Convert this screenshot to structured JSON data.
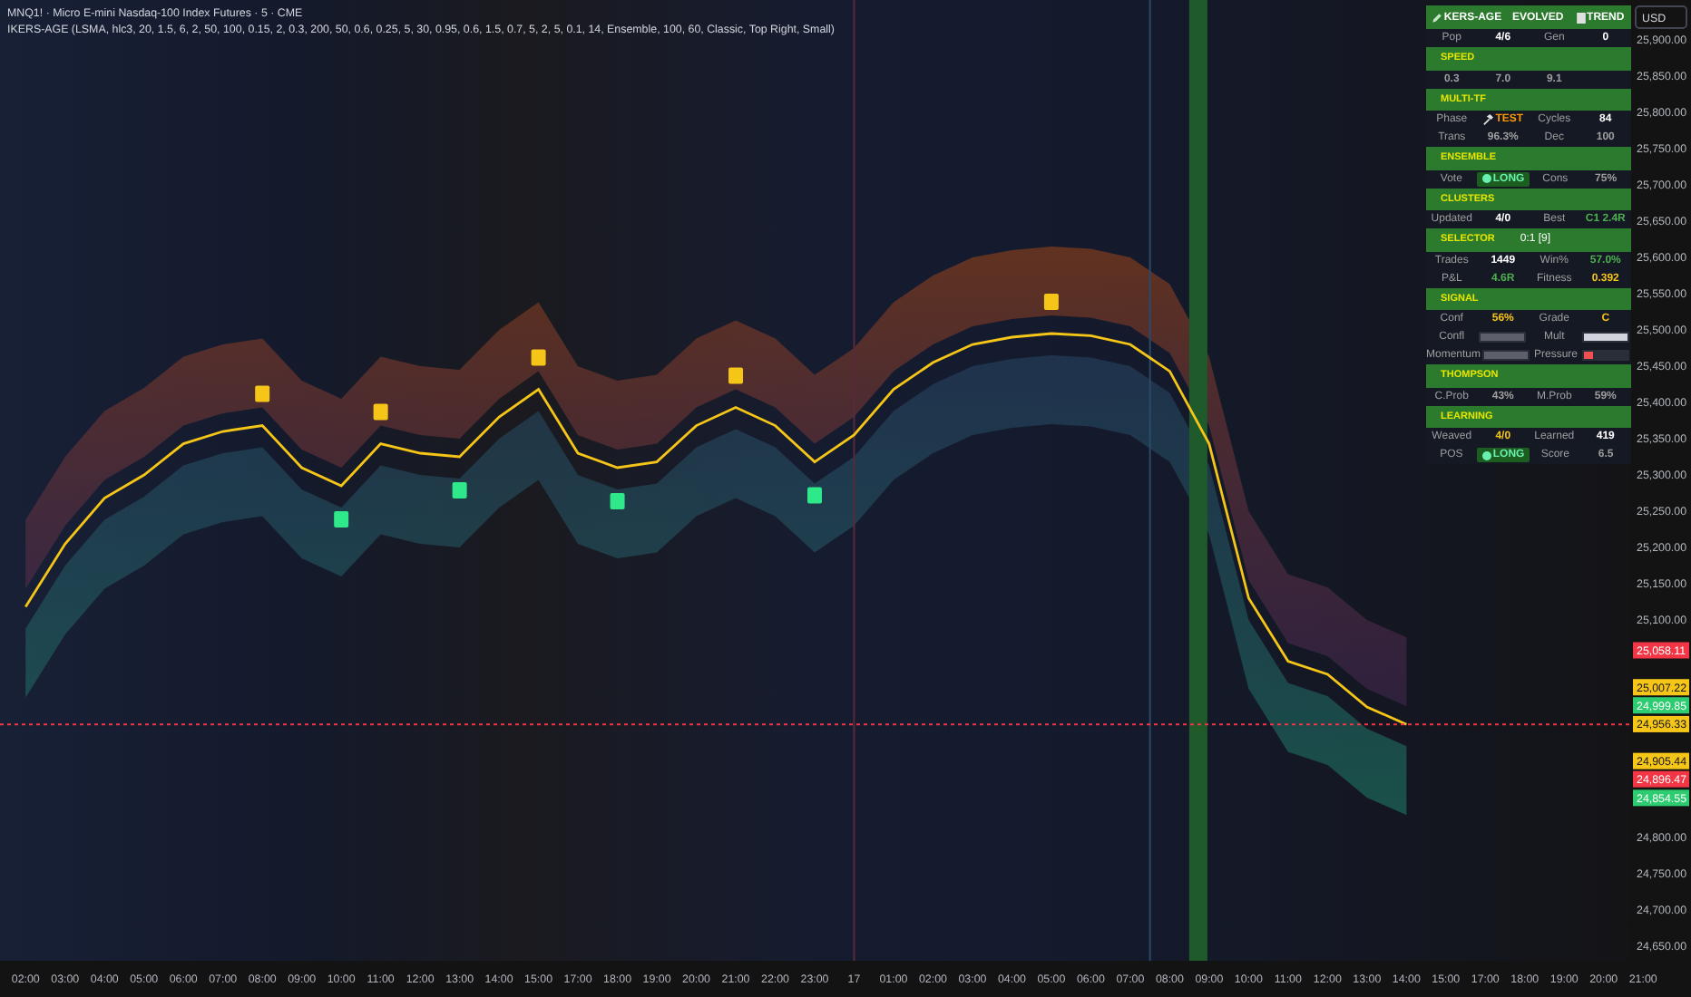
{
  "legend": {
    "symbol_line": "MNQ1! · Micro E-mini Nasdaq-100 Index Futures · 5 · CME",
    "indicator_line": "IKERS-AGE (LSMA, hlc3, 20, 1.5, 6, 2, 50, 100, 0.15, 2, 0.3, 200, 50, 0.6, 0.25, 5, 30, 0.95, 0.6, 1.5, 0.7, 5, 2, 5, 0.1, 14, Ensemble, 100, 60, Classic, Top Right, Small)"
  },
  "currency": "USD",
  "chart_data": {
    "type": "line",
    "categories": [
      "02:00",
      "03:00",
      "04:00",
      "05:00",
      "06:00",
      "07:00",
      "08:00",
      "09:00",
      "10:00",
      "11:00",
      "12:00",
      "13:00",
      "14:00",
      "15:00",
      "17:00",
      "18:00",
      "19:00",
      "20:00",
      "21:00",
      "22:00",
      "23:00",
      "17",
      "01:00",
      "02:00",
      "03:00",
      "04:00",
      "05:00",
      "06:00",
      "07:00",
      "08:00",
      "09:00",
      "10:00",
      "11:00",
      "12:00",
      "13:00",
      "14:00",
      "15:00",
      "17:00",
      "18:00",
      "19:00",
      "20:00",
      "21:00"
    ],
    "series": [
      {
        "color": "#f5c518",
        "values": [
          25118,
          25205,
          25268,
          25300,
          25343,
          25360,
          25368,
          25310,
          25285,
          25343,
          25330,
          25325,
          25380,
          25418,
          25330,
          25310,
          25318,
          25368,
          25393,
          25368,
          25318,
          25355,
          25418,
          25455,
          25480,
          25490,
          25495,
          25492,
          25480,
          25443,
          25343,
          25130,
          25043,
          25025,
          24980,
          24956,
          null,
          null,
          null,
          null,
          null,
          null
        ]
      }
    ],
    "ylim": [
      24630,
      25955
    ],
    "yticks": [
      {
        "value": 25900,
        "label": "25,900.00"
      },
      {
        "value": 25850,
        "label": "25,850.00"
      },
      {
        "value": 25800,
        "label": "25,800.00"
      },
      {
        "value": 25750,
        "label": "25,750.00"
      },
      {
        "value": 25700,
        "label": "25,700.00"
      },
      {
        "value": 25650,
        "label": "25,650.00"
      },
      {
        "value": 25600,
        "label": "25,600.00"
      },
      {
        "value": 25550,
        "label": "25,550.00"
      },
      {
        "value": 25500,
        "label": "25,500.00"
      },
      {
        "value": 25450,
        "label": "25,450.00"
      },
      {
        "value": 25400,
        "label": "25,400.00"
      },
      {
        "value": 25350,
        "label": "25,350.00"
      },
      {
        "value": 25300,
        "label": "25,300.00"
      },
      {
        "value": 25250,
        "label": "25,250.00"
      },
      {
        "value": 25200,
        "label": "25,200.00"
      },
      {
        "value": 25150,
        "label": "25,150.00"
      },
      {
        "value": 25100,
        "label": "25,100.00"
      },
      {
        "value": 24800,
        "label": "24,800.00"
      },
      {
        "value": 24750,
        "label": "24,750.00"
      },
      {
        "value": 24700,
        "label": "24,700.00"
      },
      {
        "value": 24650,
        "label": "24,650.00"
      }
    ]
  },
  "price_labels": [
    {
      "text": "25,058.11",
      "color": "#f23645"
    },
    {
      "text": "25,007.22",
      "color": "#f5c518"
    },
    {
      "text": "24,999.85",
      "color": "#2ecc71"
    },
    {
      "text": "24,956.33",
      "color": "#f5c518"
    },
    {
      "text": "24,905.44",
      "color": "#f5c518"
    },
    {
      "text": "24,896.47",
      "color": "#f23645"
    },
    {
      "text": "24,854.55",
      "color": "#2ecc71"
    }
  ],
  "panel": {
    "rows": [
      {
        "kind": "header",
        "cells": [
          {
            "kind": "brand",
            "text": "KERS-AGE"
          },
          {
            "kind": "plain",
            "text": "EVOLVED"
          },
          {
            "kind": "trend",
            "text": "TREND"
          }
        ]
      },
      {
        "kind": "stats",
        "cells": [
          {
            "kind": "label",
            "text": "Pop"
          },
          {
            "kind": "value",
            "text": "4/6",
            "color": "#ffffff"
          },
          {
            "kind": "label",
            "text": "Gen"
          },
          {
            "kind": "value",
            "text": "0",
            "color": "#ffffff"
          }
        ]
      },
      {
        "kind": "section",
        "title": "SPEED"
      },
      {
        "kind": "stats",
        "cells": [
          {
            "kind": "value",
            "text": "0.3",
            "color": "#9e9e9e"
          },
          {
            "kind": "value",
            "text": "7.0",
            "color": "#9e9e9e"
          },
          {
            "kind": "value",
            "text": "9.1",
            "color": "#9e9e9e"
          }
        ]
      },
      {
        "kind": "section",
        "title": "MULTI-TF"
      },
      {
        "kind": "stats",
        "cells": [
          {
            "kind": "label",
            "text": "Phase"
          },
          {
            "kind": "phase",
            "text": "TEST",
            "color": "#ff9800"
          },
          {
            "kind": "label",
            "text": "Cycles"
          },
          {
            "kind": "value",
            "text": "84",
            "color": "#ffffff"
          }
        ]
      },
      {
        "kind": "stats",
        "cells": [
          {
            "kind": "label",
            "text": "Trans"
          },
          {
            "kind": "value",
            "text": "96.3%",
            "color": "#9e9e9e"
          },
          {
            "kind": "label",
            "text": "Dec"
          },
          {
            "kind": "value",
            "text": "100",
            "color": "#9e9e9e"
          }
        ]
      },
      {
        "kind": "section",
        "title": "ENSEMBLE"
      },
      {
        "kind": "stats",
        "cells": [
          {
            "kind": "label",
            "text": "Vote"
          },
          {
            "kind": "pill",
            "text": "LONG",
            "color": "#69f0ae"
          },
          {
            "kind": "label",
            "text": "Cons"
          },
          {
            "kind": "value",
            "text": "75%",
            "color": "#9e9e9e"
          }
        ]
      },
      {
        "kind": "section",
        "title": "CLUSTERS"
      },
      {
        "kind": "stats",
        "cells": [
          {
            "kind": "label",
            "text": "Updated"
          },
          {
            "kind": "value",
            "text": "4/0",
            "color": "#ffffff"
          },
          {
            "kind": "label",
            "text": "Best"
          },
          {
            "kind": "value",
            "text": "C1 2.4R",
            "color": "#4caf50"
          }
        ]
      },
      {
        "kind": "section",
        "title": "SELECTOR",
        "value": "0:1 [9]"
      },
      {
        "kind": "stats",
        "cells": [
          {
            "kind": "label",
            "text": "Trades"
          },
          {
            "kind": "value",
            "text": "1449",
            "color": "#ffffff"
          },
          {
            "kind": "label",
            "text": "Win%"
          },
          {
            "kind": "value",
            "text": "57.0%",
            "color": "#4caf50"
          }
        ]
      },
      {
        "kind": "stats",
        "cells": [
          {
            "kind": "label",
            "text": "P&L"
          },
          {
            "kind": "value",
            "text": "4.6R",
            "color": "#4caf50"
          },
          {
            "kind": "label",
            "text": "Fitness"
          },
          {
            "kind": "value",
            "text": "0.392",
            "color": "#f5c518"
          }
        ]
      },
      {
        "kind": "section",
        "title": "SIGNAL"
      },
      {
        "kind": "stats",
        "cells": [
          {
            "kind": "label",
            "text": "Conf"
          },
          {
            "kind": "value",
            "text": "56%",
            "color": "#f5c518"
          },
          {
            "kind": "label",
            "text": "Grade"
          },
          {
            "kind": "value",
            "text": "C",
            "color": "#f5c518"
          }
        ]
      },
      {
        "kind": "stats",
        "cells": [
          {
            "kind": "label",
            "text": "Confl"
          },
          {
            "kind": "bar",
            "level": 1,
            "color": "#5d606b"
          },
          {
            "kind": "label",
            "text": "Mult"
          },
          {
            "kind": "bar",
            "level": 1,
            "color": "#d1d4dc"
          }
        ]
      },
      {
        "kind": "stats",
        "cells": [
          {
            "kind": "label",
            "text": "Momentum"
          },
          {
            "kind": "bar",
            "level": 1,
            "color": "#5d606b"
          },
          {
            "kind": "label",
            "text": "Pressure"
          },
          {
            "kind": "bar",
            "level": 0.2,
            "color": "#f05050"
          }
        ]
      },
      {
        "kind": "section",
        "title": "THOMPSON"
      },
      {
        "kind": "stats",
        "cells": [
          {
            "kind": "label",
            "text": "C.Prob"
          },
          {
            "kind": "value",
            "text": "43%",
            "color": "#9e9e9e"
          },
          {
            "kind": "label",
            "text": "M.Prob"
          },
          {
            "kind": "value",
            "text": "59%",
            "color": "#9e9e9e"
          }
        ]
      },
      {
        "kind": "section",
        "title": "LEARNING"
      },
      {
        "kind": "stats",
        "cells": [
          {
            "kind": "label",
            "text": "Weaved"
          },
          {
            "kind": "value",
            "text": "4/0",
            "color": "#f5c518"
          },
          {
            "kind": "label",
            "text": "Learned"
          },
          {
            "kind": "value",
            "text": "419",
            "color": "#ffffff"
          }
        ]
      },
      {
        "kind": "stats",
        "cells": [
          {
            "kind": "label",
            "text": "POS"
          },
          {
            "kind": "pill",
            "text": "LONG",
            "color": "#69f0ae"
          },
          {
            "kind": "label",
            "text": "Score"
          },
          {
            "kind": "value",
            "text": "6.5",
            "color": "#9e9e9e"
          }
        ]
      }
    ]
  }
}
